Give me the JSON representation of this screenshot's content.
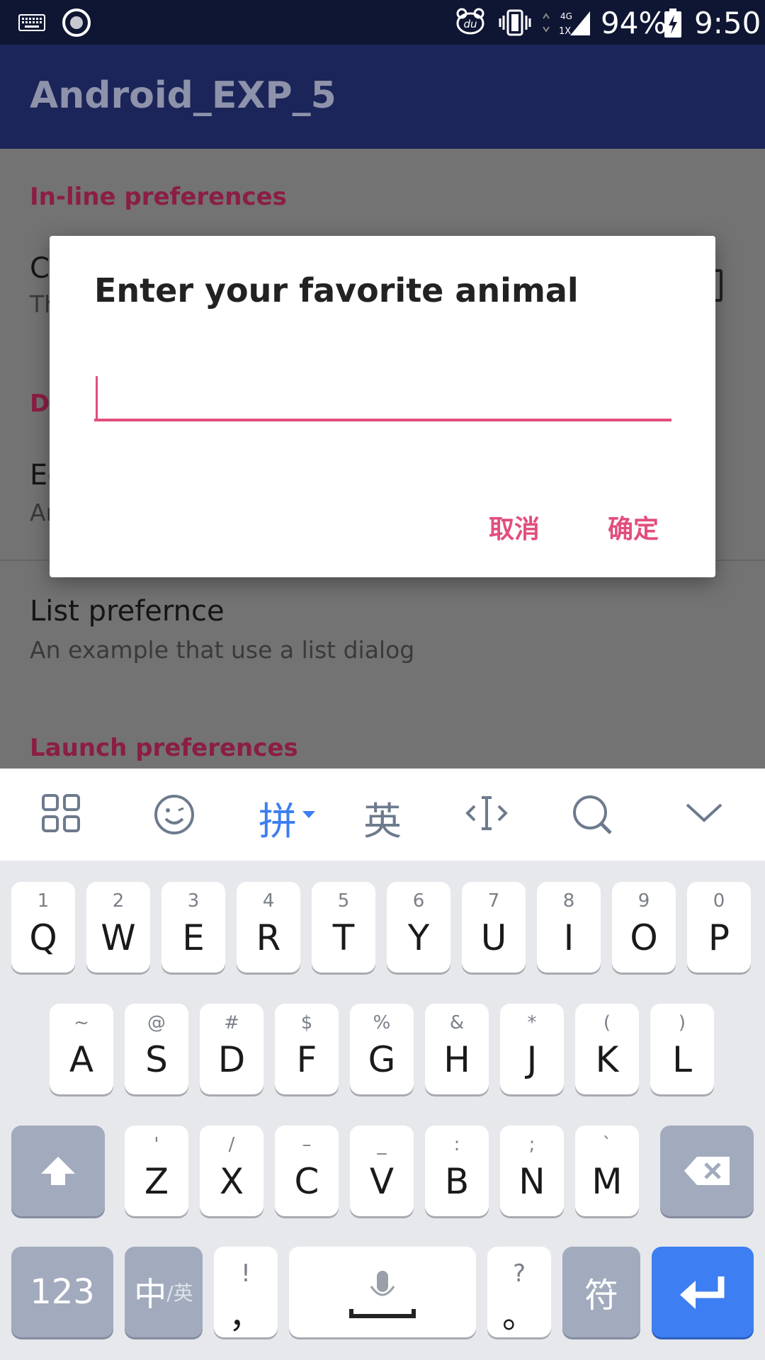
{
  "status_bar": {
    "battery_percent": "94%",
    "time": "9:50",
    "network": "4G",
    "network_sub": "1X",
    "icons": [
      "keyboard-icon",
      "record-icon",
      "du-icon",
      "vibrate-icon",
      "signal-icon",
      "battery-charging-icon"
    ]
  },
  "app_bar": {
    "title": "Android_EXP_5"
  },
  "preferences": {
    "inline_header": "In-line preferences",
    "checkbox_title_partial": "C",
    "checkbox_summary_partial": "Th",
    "dialog_header_partial": "D",
    "edit_title_partial": "Ed",
    "edit_summary_partial": "An",
    "list_title": "List prefernce",
    "list_summary": "An example that use a list dialog",
    "launch_header": "Launch preferences"
  },
  "dialog": {
    "title": "Enter your favorite animal",
    "input_value": "",
    "cancel_label": "取消",
    "ok_label": "确定"
  },
  "keyboard_toolbar": {
    "pinyin_label": "拼",
    "english_label": "英",
    "icons": [
      "grid-icon",
      "emoji-icon",
      "cursor-icon",
      "search-icon",
      "collapse-icon"
    ]
  },
  "keyboard": {
    "row1": [
      {
        "hint": "1",
        "key": "Q"
      },
      {
        "hint": "2",
        "key": "W"
      },
      {
        "hint": "3",
        "key": "E"
      },
      {
        "hint": "4",
        "key": "R"
      },
      {
        "hint": "5",
        "key": "T"
      },
      {
        "hint": "6",
        "key": "Y"
      },
      {
        "hint": "7",
        "key": "U"
      },
      {
        "hint": "8",
        "key": "I"
      },
      {
        "hint": "9",
        "key": "O"
      },
      {
        "hint": "0",
        "key": "P"
      }
    ],
    "row2": [
      {
        "hint": "~",
        "key": "A"
      },
      {
        "hint": "@",
        "key": "S"
      },
      {
        "hint": "#",
        "key": "D"
      },
      {
        "hint": "$",
        "key": "F"
      },
      {
        "hint": "%",
        "key": "G"
      },
      {
        "hint": "&",
        "key": "H"
      },
      {
        "hint": "*",
        "key": "J"
      },
      {
        "hint": "(",
        "key": "K"
      },
      {
        "hint": ")",
        "key": "L"
      }
    ],
    "row3": [
      {
        "hint": "'",
        "key": "Z"
      },
      {
        "hint": "/",
        "key": "X"
      },
      {
        "hint": "–",
        "key": "C"
      },
      {
        "hint": "_",
        "key": "V"
      },
      {
        "hint": ":",
        "key": "B"
      },
      {
        "hint": ";",
        "key": "N"
      },
      {
        "hint": "`",
        "key": "M"
      }
    ],
    "num_label": "123",
    "lang_label_main": "中",
    "lang_label_sub": "/英",
    "comma_top": "!",
    "comma_main": "，",
    "period_top": "?",
    "period_main": "。",
    "symbol_label": "符"
  }
}
